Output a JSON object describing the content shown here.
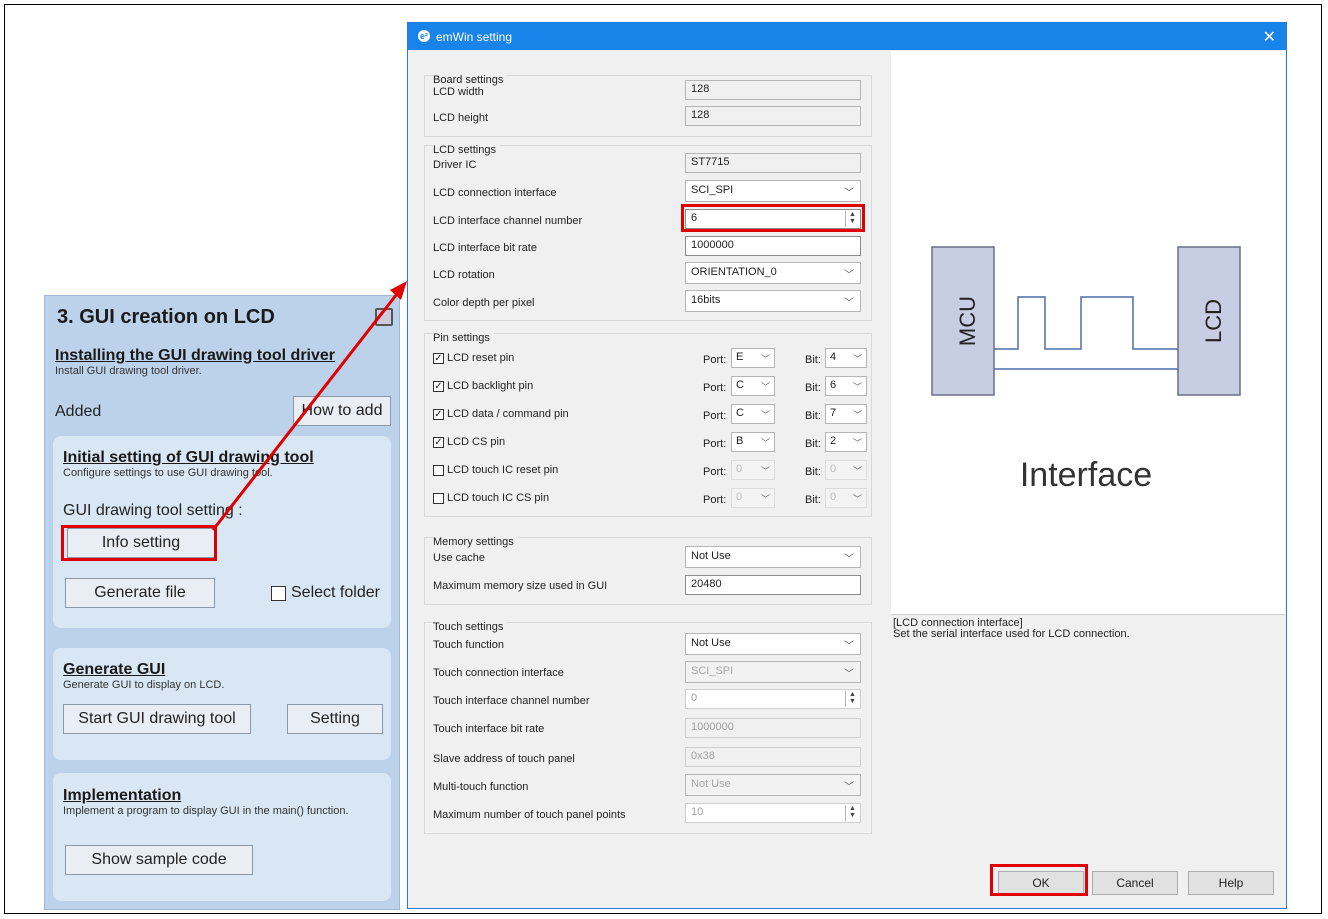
{
  "left_panel": {
    "title": "3. GUI creation on LCD",
    "install": {
      "heading": "Installing the GUI drawing tool driver",
      "sub": "Install GUI drawing tool driver.",
      "status": "Added",
      "button": "How to add"
    },
    "initial": {
      "heading": "Initial setting of GUI drawing tool",
      "sub": "Configure settings to use GUI drawing tool.",
      "label": "GUI drawing tool setting :",
      "info_button": "Info setting",
      "generate_button": "Generate file",
      "select_folder": "Select folder"
    },
    "generate": {
      "heading": "Generate GUI",
      "sub": "Generate GUI to display on LCD.",
      "start_button": "Start GUI drawing tool",
      "setting_button": "Setting"
    },
    "implementation": {
      "heading": "Implementation",
      "sub": "Implement a program to display GUI in the main() function.",
      "button": "Show sample code"
    }
  },
  "dialog": {
    "title": "emWin setting",
    "close": "✕",
    "board": {
      "group": "Board settings",
      "width_label": "LCD width",
      "width_value": "128",
      "height_label": "LCD height",
      "height_value": "128"
    },
    "lcd": {
      "group": "LCD settings",
      "driver_label": "Driver IC",
      "driver_value": "ST7715",
      "conn_label": "LCD connection interface",
      "conn_value": "SCI_SPI",
      "channel_label": "LCD interface channel number",
      "channel_value": "6",
      "bitrate_label": "LCD interface bit rate",
      "bitrate_value": "1000000",
      "rotation_label": "LCD rotation",
      "rotation_value": "ORIENTATION_0",
      "depth_label": "Color depth per pixel",
      "depth_value": "16bits"
    },
    "pins": {
      "group": "Pin settings",
      "port_label": "Port:",
      "bit_label": "Bit:",
      "rows": [
        {
          "label": "LCD reset pin",
          "port": "E",
          "bit": "4"
        },
        {
          "label": "LCD backlight pin",
          "port": "C",
          "bit": "6"
        },
        {
          "label": "LCD data / command pin",
          "port": "C",
          "bit": "7"
        },
        {
          "label": "LCD CS pin",
          "port": "B",
          "bit": "2"
        },
        {
          "label": "LCD touch IC reset pin",
          "port": "0",
          "bit": "0"
        },
        {
          "label": "LCD touch IC CS pin",
          "port": "0",
          "bit": "0"
        }
      ]
    },
    "memory": {
      "group": "Memory settings",
      "cache_label": "Use cache",
      "cache_value": "Not Use",
      "max_label": "Maximum memory size used in GUI",
      "max_value": "20480"
    },
    "touch": {
      "group": "Touch settings",
      "function_label": "Touch function",
      "function_value": "Not Use",
      "conn_label": "Touch connection interface",
      "conn_value": "SCI_SPI",
      "channel_label": "Touch interface channel number",
      "channel_value": "0",
      "bitrate_label": "Touch interface bit rate",
      "bitrate_value": "1000000",
      "slave_label": "Slave address of touch panel",
      "slave_value": "0x38",
      "multi_label": "Multi-touch function",
      "multi_value": "Not Use",
      "points_label": "Maximum number of touch panel points",
      "points_value": "10"
    },
    "preview": {
      "mcu": "MCU",
      "lcd": "LCD",
      "caption": "Interface"
    },
    "description": {
      "title": "[LCD connection interface]",
      "text": "Set the serial interface used for LCD connection."
    },
    "buttons": {
      "ok": "OK",
      "cancel": "Cancel",
      "help": "Help"
    }
  },
  "colors": {
    "highlight": "#e00000",
    "titlebar": "#1883e8",
    "panel": "#bcd2ea"
  }
}
